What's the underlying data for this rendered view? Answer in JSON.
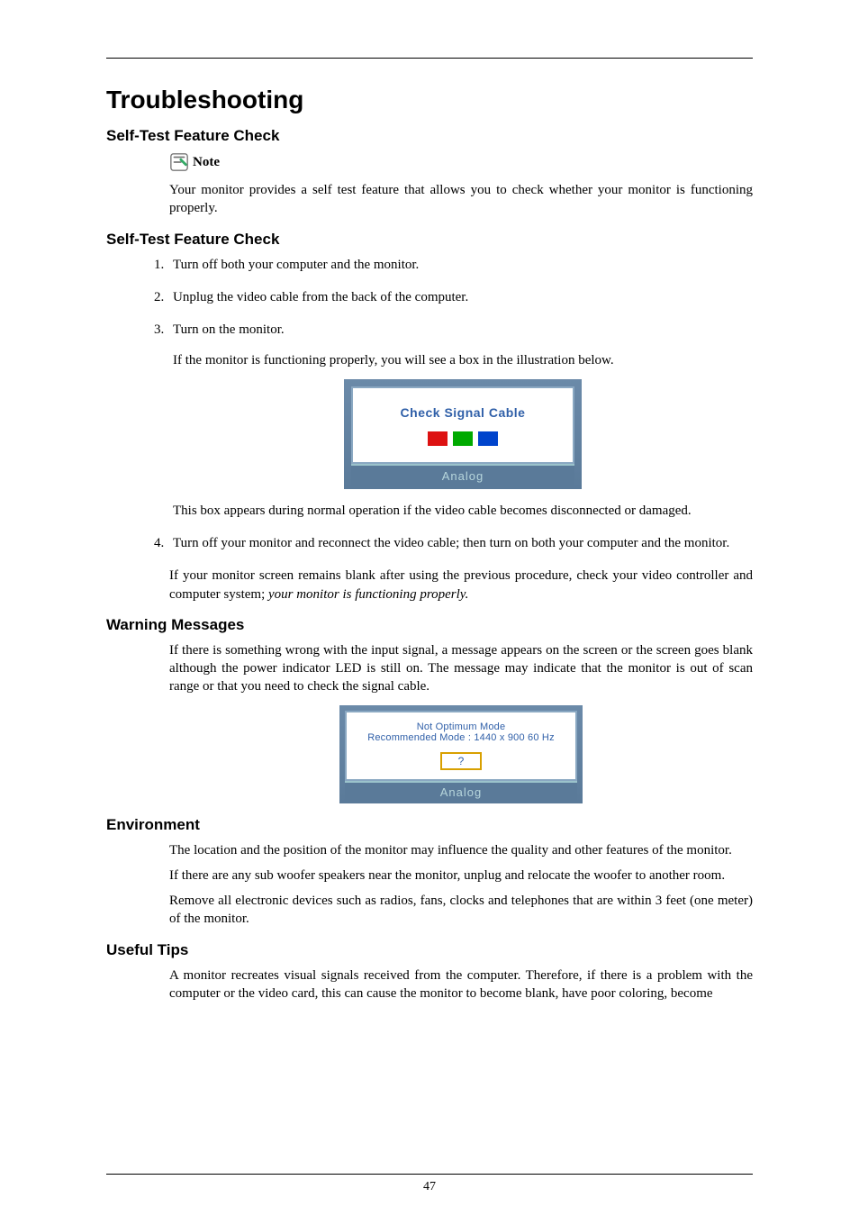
{
  "pageNumber": "47",
  "title": "Troubleshooting",
  "sections": {
    "selftest1": {
      "heading": "Self-Test Feature Check",
      "noteLabel": "Note",
      "noteBody": "Your monitor provides a self test feature that allows you to check whether your monitor is functioning properly."
    },
    "selftest2": {
      "heading": "Self-Test Feature Check",
      "steps": {
        "s1": "Turn off both your computer and the monitor.",
        "s2": "Unplug the video cable from the back of the computer.",
        "s3a": "Turn on the monitor.",
        "s3b": "If the monitor is functioning properly, you will see a box in the illustration below.",
        "s3c": "This box appears during normal operation if the video cable becomes disconnected or damaged.",
        "s4": "Turn off your monitor and reconnect the video cable; then turn on both your computer and the monitor."
      },
      "closing": {
        "plain": "If your monitor screen remains blank after using the previous procedure, check your video controller and computer system; ",
        "italic": "your monitor is functioning properly."
      },
      "fig1": {
        "title": "Check Signal Cable",
        "footer": "Analog"
      }
    },
    "warning": {
      "heading": "Warning Messages",
      "body": "If there is something wrong with the input signal, a message appears on the screen or the screen goes blank although the power indicator LED is still on. The message may indicate that the monitor is out of scan range or that you need to check the signal cable.",
      "fig2": {
        "line1": "Not Optimum Mode",
        "line2": "Recommended Mode : 1440 x 900 60 Hz",
        "q": "?",
        "footer": "Analog"
      }
    },
    "environment": {
      "heading": "Environment",
      "p1": "The location and the position of the monitor may influence the quality and other features of the monitor.",
      "p2": "If there are any sub woofer speakers near the monitor, unplug and relocate the woofer to another room.",
      "p3": "Remove all electronic devices such as radios, fans, clocks and telephones that are within 3 feet (one meter) of the monitor."
    },
    "tips": {
      "heading": "Useful Tips",
      "p1": "A monitor recreates visual signals received from the computer. Therefore, if there is a problem with the computer or the video card, this can cause the monitor to become blank, have poor coloring, become"
    }
  }
}
